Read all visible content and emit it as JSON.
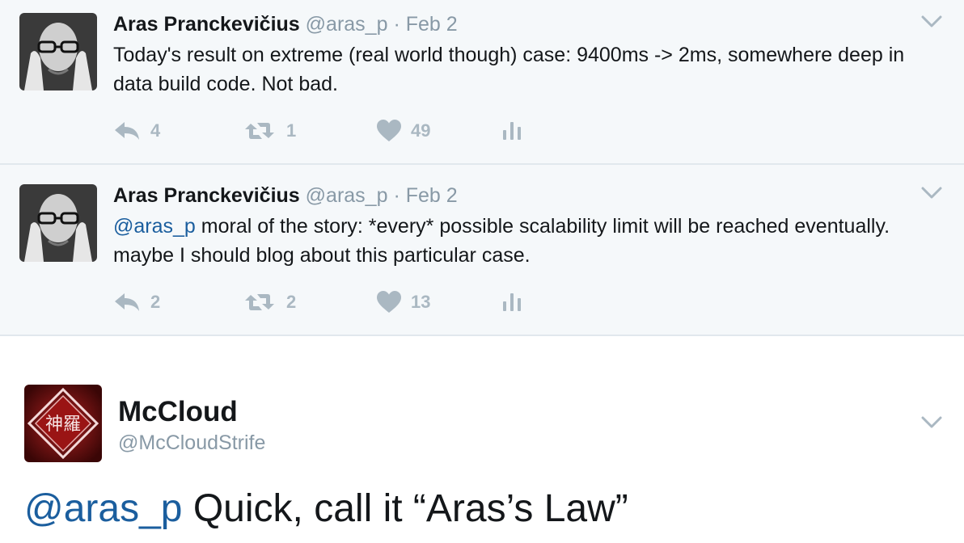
{
  "tweets": [
    {
      "name": "Aras Pranckevičius",
      "handle": "@aras_p",
      "separator": "·",
      "date": "Feb 2",
      "mention": "",
      "text": "Today's result on extreme (real world though) case: 9400ms -> 2ms, somewhere deep in data build code. Not bad.",
      "replies": "4",
      "retweets": "1",
      "likes": "49"
    },
    {
      "name": "Aras Pranckevičius",
      "handle": "@aras_p",
      "separator": "·",
      "date": "Feb 2",
      "mention": "@aras_p",
      "text": " moral of the story: *every* possible scalability limit will be reached eventually. maybe I should blog about this particular case.",
      "replies": "2",
      "retweets": "2",
      "likes": "13"
    }
  ],
  "main_tweet": {
    "name": "McCloud",
    "handle": "@McCloudStrife",
    "mention": "@aras_p",
    "text": " Quick, call it “Aras’s Law”",
    "avatar_text": "神羅"
  },
  "icons": {
    "reply": "reply-icon",
    "retweet": "retweet-icon",
    "like": "heart-icon",
    "analytics": "analytics-icon",
    "menu": "chevron-down-icon"
  },
  "colors": {
    "action_gray": "#aab8c2",
    "mention_blue": "#1b5e9e",
    "subtle_bg": "#f5f8fa",
    "avatar_red": "#8b1a1a"
  }
}
